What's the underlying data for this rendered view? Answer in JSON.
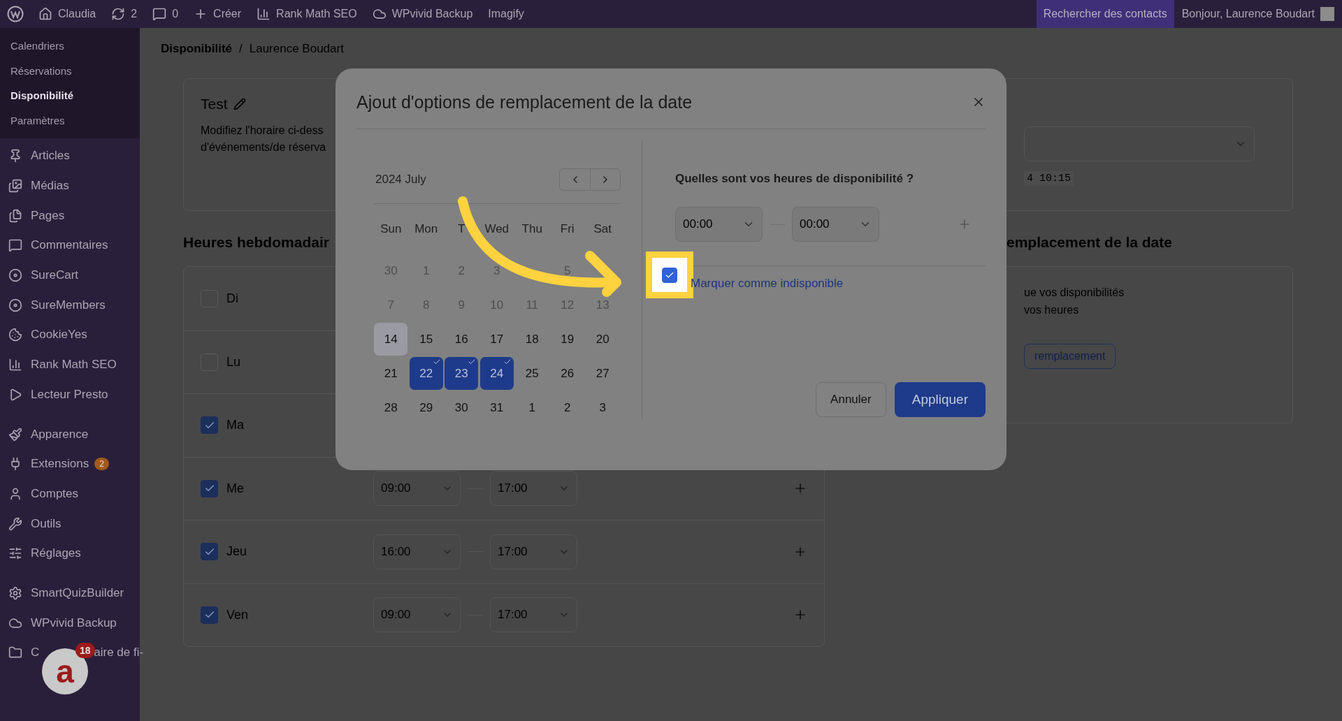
{
  "admin_bar": {
    "site": "Claudia",
    "updates": "2",
    "comments": "0",
    "create": "Créer",
    "items": [
      "Rank Math SEO",
      "WPvivid Backup",
      "Imagify"
    ],
    "search_contacts": "Rechercher des contacts",
    "greeting": "Bonjour, Laurence Boudart"
  },
  "sidebar": {
    "submenu": [
      {
        "label": "Calendriers",
        "selected": false
      },
      {
        "label": "Réservations",
        "selected": false
      },
      {
        "label": "Disponibilité",
        "selected": true
      },
      {
        "label": "Paramètres",
        "selected": false
      }
    ],
    "groups": [
      [
        {
          "label": "Articles"
        },
        {
          "label": "Médias"
        },
        {
          "label": "Pages"
        },
        {
          "label": "Commentaires"
        },
        {
          "label": "SureCart"
        },
        {
          "label": "SureMembers"
        },
        {
          "label": "CookieYes"
        },
        {
          "label": "Rank Math SEO"
        },
        {
          "label": "Lecteur Presto"
        }
      ],
      [
        {
          "label": "Apparence"
        },
        {
          "label": "Extensions",
          "badge": "2"
        },
        {
          "label": "Comptes"
        },
        {
          "label": "Outils"
        },
        {
          "label": "Réglages"
        }
      ],
      [
        {
          "label": "SmartQuizBuilder"
        },
        {
          "label": "WPvivid Backup"
        },
        {
          "label": "C",
          "label_tail": "aire de fi-"
        }
      ]
    ]
  },
  "chat_widget": {
    "logo_letter": "a",
    "badge": "18"
  },
  "breadcrumb": {
    "current": "Disponibilité",
    "separator": "/",
    "parent": "Laurence Boudart"
  },
  "schedule_card": {
    "title": "Test",
    "lines": [
      "Modifiez l'horaire ci-dess",
      "d'événements/de réserva"
    ]
  },
  "weekly": {
    "heading": "Heures hebdomadair",
    "days": [
      {
        "label": "Di",
        "checked": false
      },
      {
        "label": "Lu",
        "checked": false
      },
      {
        "label": "Ma",
        "checked": true
      },
      {
        "label": "Me",
        "checked": true,
        "start": "09:00",
        "end": "17:00"
      },
      {
        "label": "Jeu",
        "checked": true,
        "start": "16:00",
        "end": "17:00"
      },
      {
        "label": "Ven",
        "checked": true,
        "start": "09:00",
        "end": "17:00"
      }
    ]
  },
  "right_panel": {
    "timestamp_fragment": "4 10:15",
    "override_heading": "emplacement de la date",
    "override_lines": [
      "ue vos disponibilités",
      "vos heures"
    ],
    "override_button": "remplacement"
  },
  "modal": {
    "title": "Ajout d'options de remplacement de la date",
    "month": "2024 July",
    "weekdays": [
      "Sun",
      "Mon",
      "T",
      "Wed",
      "Thu",
      "Fri",
      "Sat"
    ],
    "weeks": [
      [
        {
          "kind": "day",
          "d": "30",
          "outside": true,
          "today": false,
          "selected": false
        },
        {
          "kind": "day",
          "d": "1",
          "outside": true,
          "today": false,
          "selected": false
        },
        {
          "kind": "day",
          "d": "2",
          "outside": true,
          "today": false,
          "selected": false
        },
        {
          "kind": "day",
          "d": "3",
          "outside": true,
          "today": false,
          "selected": false
        },
        {
          "kind": "covered"
        },
        {
          "kind": "day",
          "d": "5",
          "outside": true,
          "today": false,
          "selected": false
        },
        {
          "kind": "covered"
        }
      ],
      [
        {
          "kind": "day",
          "d": "7",
          "outside": true,
          "today": false,
          "selected": false
        },
        {
          "kind": "day",
          "d": "8",
          "outside": true,
          "today": false,
          "selected": false
        },
        {
          "kind": "day",
          "d": "9",
          "outside": true,
          "today": false,
          "selected": false
        },
        {
          "kind": "day",
          "d": "10",
          "outside": true,
          "today": false,
          "selected": false
        },
        {
          "kind": "day",
          "d": "11",
          "outside": true,
          "today": false,
          "selected": false
        },
        {
          "kind": "day",
          "d": "12",
          "outside": true,
          "today": false,
          "selected": false
        },
        {
          "kind": "day",
          "d": "13",
          "outside": true,
          "today": false,
          "selected": false
        }
      ],
      [
        {
          "kind": "day",
          "d": "14",
          "outside": false,
          "today": true,
          "selected": false
        },
        {
          "kind": "day",
          "d": "15",
          "outside": false,
          "today": false,
          "selected": false
        },
        {
          "kind": "day",
          "d": "16",
          "outside": false,
          "today": false,
          "selected": false
        },
        {
          "kind": "day",
          "d": "17",
          "outside": false,
          "today": false,
          "selected": false
        },
        {
          "kind": "day",
          "d": "18",
          "outside": false,
          "today": false,
          "selected": false
        },
        {
          "kind": "day",
          "d": "19",
          "outside": false,
          "today": false,
          "selected": false
        },
        {
          "kind": "day",
          "d": "20",
          "outside": false,
          "today": false,
          "selected": false
        }
      ],
      [
        {
          "kind": "day",
          "d": "21",
          "outside": false,
          "today": false,
          "selected": false
        },
        {
          "kind": "day",
          "d": "22",
          "outside": false,
          "today": false,
          "selected": true
        },
        {
          "kind": "day",
          "d": "23",
          "outside": false,
          "today": false,
          "selected": true
        },
        {
          "kind": "day",
          "d": "24",
          "outside": false,
          "today": false,
          "selected": true
        },
        {
          "kind": "day",
          "d": "25",
          "outside": false,
          "today": false,
          "selected": false
        },
        {
          "kind": "day",
          "d": "26",
          "outside": false,
          "today": false,
          "selected": false
        },
        {
          "kind": "day",
          "d": "27",
          "outside": false,
          "today": false,
          "selected": false
        }
      ],
      [
        {
          "kind": "day",
          "d": "28",
          "outside": false,
          "today": false,
          "selected": false
        },
        {
          "kind": "day",
          "d": "29",
          "outside": false,
          "today": false,
          "selected": false
        },
        {
          "kind": "day",
          "d": "30",
          "outside": false,
          "today": false,
          "selected": false
        },
        {
          "kind": "day",
          "d": "31",
          "outside": false,
          "today": false,
          "selected": false
        },
        {
          "kind": "day",
          "d": "1",
          "outside": false,
          "today": false,
          "selected": false
        },
        {
          "kind": "day",
          "d": "2",
          "outside": false,
          "today": false,
          "selected": false
        },
        {
          "kind": "day",
          "d": "3",
          "outside": false,
          "today": false,
          "selected": false
        }
      ]
    ],
    "question": "Quelles sont vos heures de disponibilité ?",
    "start": "00:00",
    "end": "00:00",
    "unavailable": {
      "label": "Marquer comme indisponible",
      "checked": true
    },
    "cancel": "Annuler",
    "apply": "Appliquer"
  }
}
